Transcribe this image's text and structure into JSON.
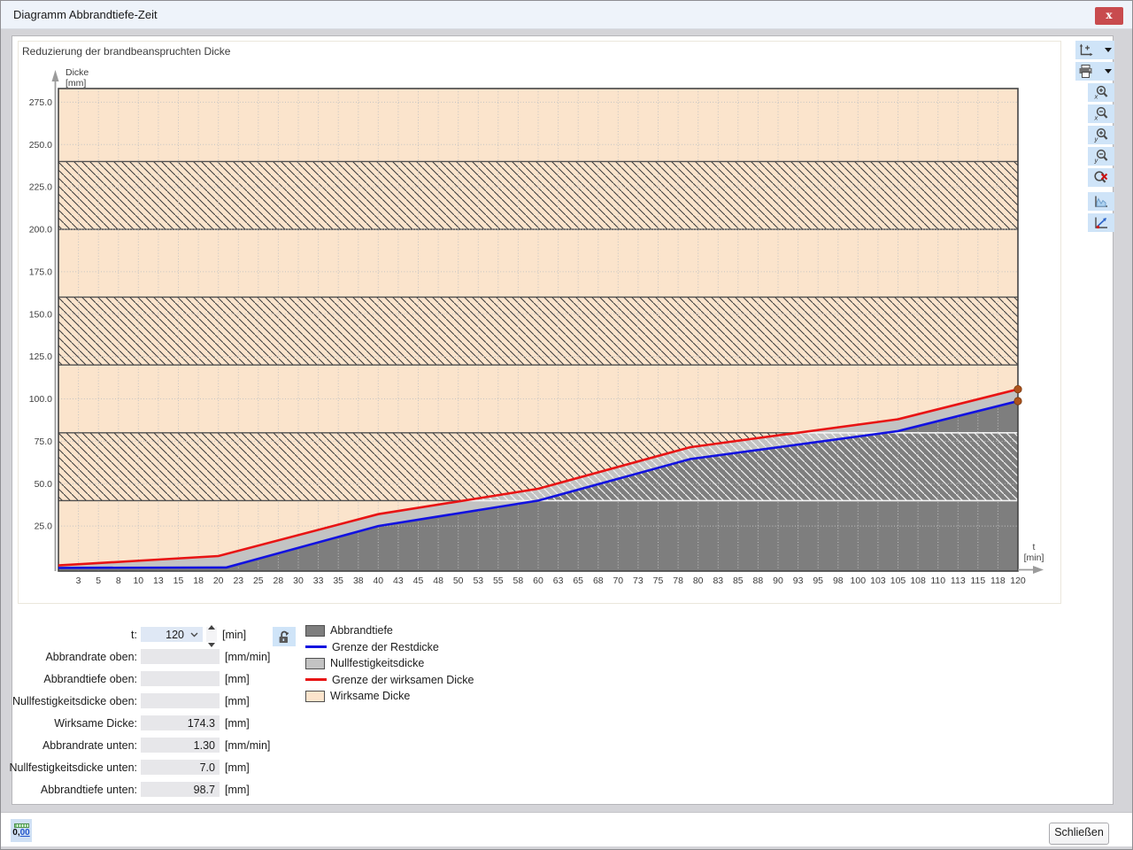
{
  "window": {
    "title": "Diagramm Abbrandtiefe-Zeit",
    "close_glyph": "x"
  },
  "chart_data": {
    "type": "area",
    "title": "Reduzierung der brandbeanspruchten Dicke",
    "ylabel_line1": "Dicke",
    "ylabel_line2": "[mm]",
    "xlabel_line1": "t",
    "xlabel_line2": "[min]",
    "xlim": [
      0,
      120
    ],
    "ylim_mm": [
      0,
      283
    ],
    "total_thickness_mm": 280,
    "x_tick_step_min": 2.5,
    "x_tick_labels": [
      "3",
      "5",
      "8",
      "10",
      "13",
      "15",
      "18",
      "20",
      "23",
      "25",
      "28",
      "30",
      "33",
      "35",
      "38",
      "40",
      "43",
      "45",
      "48",
      "50",
      "53",
      "55",
      "58",
      "60",
      "63",
      "65",
      "68",
      "70",
      "73",
      "75",
      "78",
      "80",
      "83",
      "85",
      "88",
      "90",
      "93",
      "95",
      "98",
      "100",
      "103",
      "105",
      "108",
      "110",
      "113",
      "115",
      "118",
      "120"
    ],
    "y_tick_values_mm": [
      25,
      50,
      75,
      100,
      125,
      150,
      175,
      200,
      225,
      250,
      275
    ],
    "y_tick_labels": [
      "25.0",
      "50.0",
      "75.0",
      "100.0",
      "125.0",
      "150.0",
      "175.0",
      "200.0",
      "225.0",
      "250.0",
      "275.0"
    ],
    "layer_boundaries_mm": [
      40,
      80,
      120,
      160,
      200,
      240
    ],
    "hatched_layers_mm": [
      [
        40,
        80
      ],
      [
        120,
        160
      ],
      [
        200,
        240
      ]
    ],
    "grid": true,
    "series": [
      {
        "name": "Grenze der Restdicke",
        "color": "#1212e0",
        "points": [
          [
            0,
            0.3
          ],
          [
            21,
            0.6
          ],
          [
            40,
            25
          ],
          [
            60,
            40
          ],
          [
            79,
            64.5
          ],
          [
            105,
            81
          ],
          [
            120,
            98.7
          ]
        ]
      },
      {
        "name": "Grenze der wirksamen Dicke",
        "color": "#e81414",
        "points": [
          [
            0,
            1.8
          ],
          [
            20,
            7.3
          ],
          [
            40,
            32
          ],
          [
            60,
            47
          ],
          [
            79,
            71.5
          ],
          [
            105,
            88
          ],
          [
            120,
            105.7
          ]
        ]
      }
    ],
    "areas": {
      "abbrandtiefe_color": "#7e7e7e",
      "nullfestigkeitsdicke_color": "#c3c3c3",
      "wirksame_dicke_color": "#fbe4cc"
    },
    "end_marker": {
      "t": 120,
      "color": "#ad531d",
      "values_mm": [
        98.7,
        105.7
      ]
    },
    "colors": {
      "hatch_dark": "#3a3a3a",
      "hatch_light": "#f4f4f4",
      "grid": "#c2c2c2",
      "band_line": "#4f4f4f",
      "border": "#454545",
      "axis": "#9b9b9b",
      "tick_text": "#3d3d3d"
    }
  },
  "toolbar": {
    "buttons": [
      {
        "icon": "axes-plus-icon",
        "split": true
      },
      {
        "icon": "printer-icon",
        "split": true
      },
      {
        "icon": "zoom-x-in-icon"
      },
      {
        "icon": "zoom-x-out-icon"
      },
      {
        "icon": "zoom-y-in-icon"
      },
      {
        "icon": "zoom-y-out-icon"
      },
      {
        "icon": "zoom-reset-icon"
      },
      {
        "icon": "area-display-icon",
        "gap": true
      },
      {
        "icon": "fit-points-icon"
      }
    ]
  },
  "form": {
    "rows": [
      {
        "label": "t:",
        "value": "120",
        "unit": "[min]",
        "type": "combo"
      },
      {
        "label": "Abbrandrate oben:",
        "value": "",
        "unit": "[mm/min]"
      },
      {
        "label": "Abbrandtiefe oben:",
        "value": "",
        "unit": "[mm]"
      },
      {
        "label": "Nullfestigkeitsdicke oben:",
        "value": "",
        "unit": "[mm]"
      },
      {
        "label": "Wirksame Dicke:",
        "value": "174.3",
        "unit": "[mm]"
      },
      {
        "label": "Abbrandrate unten:",
        "value": "1.30",
        "unit": "[mm/min]"
      },
      {
        "label": "Nullfestigkeitsdicke unten:",
        "value": "7.0",
        "unit": "[mm]"
      },
      {
        "label": "Abbrandtiefe unten:",
        "value": "98.7",
        "unit": "[mm]"
      }
    ]
  },
  "legend": {
    "items": [
      {
        "swatch": "area",
        "color": "#7e7e7e",
        "label": "Abbrandtiefe"
      },
      {
        "swatch": "line",
        "color": "#1212e0",
        "label": "Grenze der Restdicke"
      },
      {
        "swatch": "area",
        "color": "#c3c3c3",
        "label": "Nullfestigkeitsdicke"
      },
      {
        "swatch": "line",
        "color": "#e81414",
        "label": "Grenze der wirksamen Dicke"
      },
      {
        "swatch": "area",
        "color": "#fbe4cc",
        "label": "Wirksame Dicke"
      }
    ]
  },
  "footer": {
    "close_label": "Schließen",
    "decimals_int": "0,",
    "decimals_frac": "00"
  }
}
